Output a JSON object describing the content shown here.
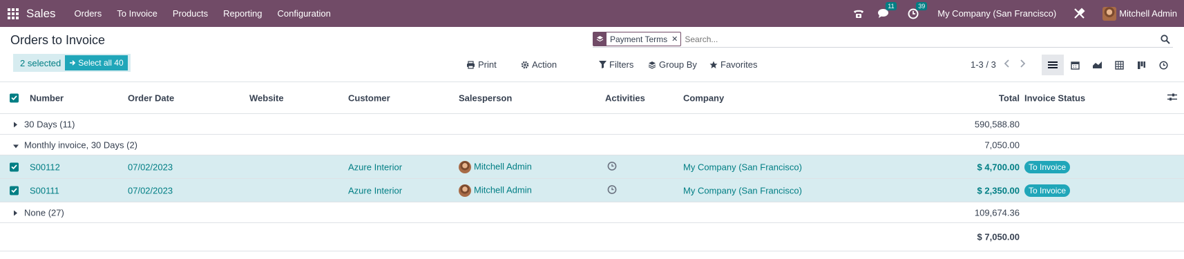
{
  "navbar": {
    "brand": "Sales",
    "menu": [
      "Orders",
      "To Invoice",
      "Products",
      "Reporting",
      "Configuration"
    ],
    "messages_count": "11",
    "activities_count": "39",
    "company": "My Company (San Francisco)",
    "user": "Mitchell Admin",
    "bg_color": "#714b67"
  },
  "control": {
    "title": "Orders to Invoice",
    "selected_text": "2 selected",
    "select_all": "Select all 40",
    "print": "Print",
    "action": "Action",
    "filters": "Filters",
    "group_by": "Group By",
    "favorites": "Favorites",
    "facet": "Payment Terms",
    "search_placeholder": "Search...",
    "pager": "1-3 / 3"
  },
  "columns": [
    "Number",
    "Order Date",
    "Website",
    "Customer",
    "Salesperson",
    "Activities",
    "Company",
    "Total",
    "Invoice Status"
  ],
  "groups": [
    {
      "label": "30 Days (11)",
      "total": "590,588.80"
    },
    {
      "label": "Monthly invoice, 30 Days (2)",
      "total": "7,050.00"
    },
    {
      "label": "None (27)",
      "total": "109,674.36"
    }
  ],
  "records": [
    {
      "number": "S00112",
      "date": "07/02/2023",
      "customer": "Azure Interior",
      "salesperson": "Mitchell Admin",
      "company": "My Company (San Francisco)",
      "total": "$ 4,700.00",
      "status": "To Invoice"
    },
    {
      "number": "S00111",
      "date": "07/02/2023",
      "customer": "Azure Interior",
      "salesperson": "Mitchell Admin",
      "company": "My Company (San Francisco)",
      "total": "$ 2,350.00",
      "status": "To Invoice"
    }
  ],
  "footer_total": "$ 7,050.00",
  "accent_color": "#017e84"
}
